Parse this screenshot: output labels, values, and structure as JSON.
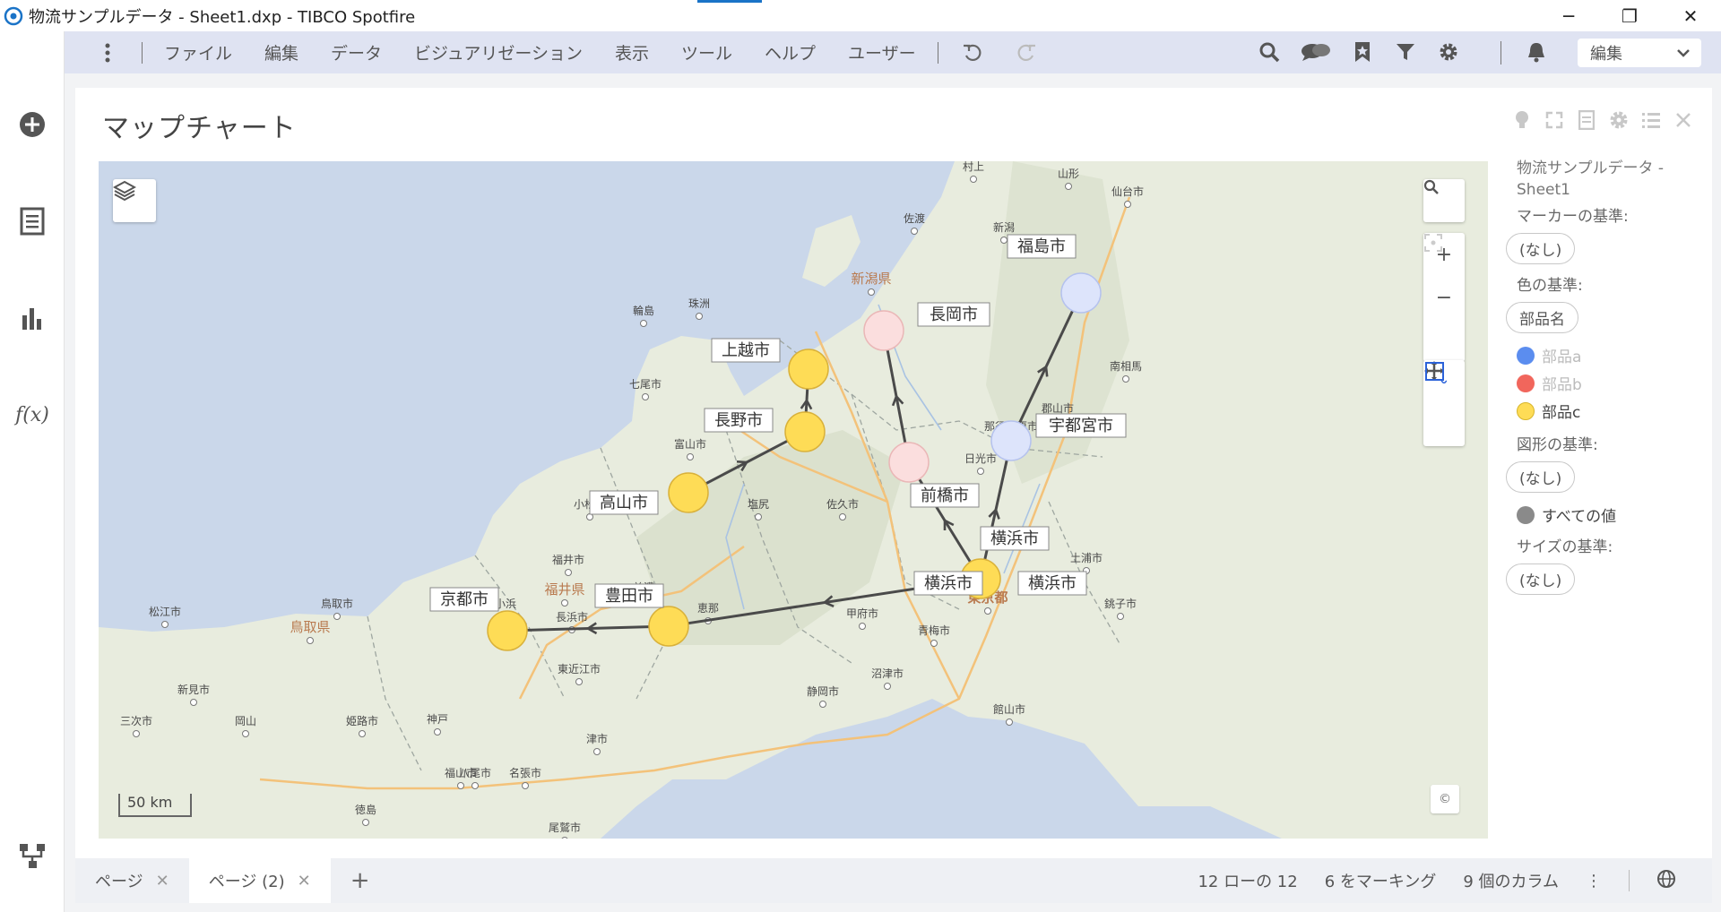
{
  "window": {
    "title": "物流サンプルデータ - Sheet1.dxp - TIBCO Spotfire",
    "min": "─",
    "max": "❐",
    "close": "✕"
  },
  "menu": {
    "items": [
      "ファイル",
      "編集",
      "データ",
      "ビジュアリゼーション",
      "表示",
      "ツール",
      "ヘルプ",
      "ユーザー"
    ],
    "mode": "編集"
  },
  "panel": {
    "title": "マップチャート"
  },
  "map": {
    "scale_label": "50 km",
    "copyright": "©",
    "zoom_in": "+",
    "zoom_out": "−",
    "base_labels": [
      {
        "t": "仙台市"
      },
      {
        "t": "山形"
      },
      {
        "t": "村上"
      },
      {
        "t": "新潟"
      },
      {
        "t": "新潟県"
      },
      {
        "t": "佐渡"
      },
      {
        "t": "輪島"
      },
      {
        "t": "珠洲"
      },
      {
        "t": "七尾市"
      },
      {
        "t": "富山市"
      },
      {
        "t": "小松市"
      },
      {
        "t": "福井市"
      },
      {
        "t": "福井県"
      },
      {
        "t": "鳥取県"
      },
      {
        "t": "鳥取市"
      },
      {
        "t": "松江市"
      },
      {
        "t": "新見市"
      },
      {
        "t": "三次市"
      },
      {
        "t": "岡山"
      },
      {
        "t": "姫路市"
      },
      {
        "t": "神戸"
      },
      {
        "t": "八尾市"
      },
      {
        "t": "名張市"
      },
      {
        "t": "津市"
      },
      {
        "t": "静岡市"
      },
      {
        "t": "沼津市"
      },
      {
        "t": "甲府市"
      },
      {
        "t": "東京都"
      },
      {
        "t": "土浦市"
      },
      {
        "t": "銚子市"
      },
      {
        "t": "日光市"
      },
      {
        "t": "郡山市"
      },
      {
        "t": "南相馬"
      },
      {
        "t": "佐久市"
      },
      {
        "t": "塩尻"
      },
      {
        "t": "美濃"
      },
      {
        "t": "恵那"
      },
      {
        "t": "長浜市"
      },
      {
        "t": "東近江市"
      },
      {
        "t": "小浜"
      },
      {
        "t": "福山市"
      },
      {
        "t": "徳島"
      },
      {
        "t": "尾鷲市"
      },
      {
        "t": "館山市"
      },
      {
        "t": "青梅市"
      },
      {
        "t": "那須塩原市"
      }
    ],
    "city_labels": [
      "福島市",
      "長岡市",
      "上越市",
      "長野市",
      "宇都宮市",
      "前橋市",
      "高山市",
      "横浜市",
      "横浜市",
      "横浜市",
      "豊田市",
      "京都市"
    ],
    "markers": [
      {
        "city": "福島市",
        "part": "部品a"
      },
      {
        "city": "宇都宮市",
        "part": "部品a"
      },
      {
        "city": "長岡市",
        "part": "部品b"
      },
      {
        "city": "前橋市",
        "part": "部品b"
      },
      {
        "city": "上越市",
        "part": "部品c"
      },
      {
        "city": "長野市",
        "part": "部品c"
      },
      {
        "city": "高山市",
        "part": "部品c"
      },
      {
        "city": "横浜市",
        "part": "部品c"
      },
      {
        "city": "豊田市",
        "part": "部品c"
      },
      {
        "city": "京都市",
        "part": "部品c"
      }
    ],
    "routes": [
      [
        "宇都宮市",
        "福島市"
      ],
      [
        "横浜市",
        "宇都宮市"
      ],
      [
        "前橋市",
        "長岡市"
      ],
      [
        "横浜市",
        "前橋市"
      ],
      [
        "長野市",
        "上越市"
      ],
      [
        "高山市",
        "長野市"
      ],
      [
        "横浜市",
        "豊田市"
      ],
      [
        "豊田市",
        "京都市"
      ]
    ]
  },
  "legend": {
    "dataset": "物流サンプルデータ - Sheet1",
    "marker_by_label": "マーカーの基準:",
    "marker_by_value": "(なし)",
    "color_by_label": "色の基準:",
    "color_by_value": "部品名",
    "color_items": [
      {
        "label": "部品a",
        "color": "#5b8def",
        "active": false
      },
      {
        "label": "部品b",
        "color": "#f1665c",
        "active": false
      },
      {
        "label": "部品c",
        "color": "#fedc56",
        "active": true
      }
    ],
    "shape_by_label": "図形の基準:",
    "shape_by_value": "(なし)",
    "shape_all_label": "すべての値",
    "size_by_label": "サイズの基準:",
    "size_by_value": "(なし)"
  },
  "bottom": {
    "tabs": [
      "ページ",
      "ページ (2)"
    ],
    "add": "+",
    "rows": "12 ローの 12",
    "marked": "6 をマーキング",
    "columns": "9 個のカラム",
    "more": "⋮"
  },
  "colors": {
    "accent": "#1a73c7",
    "part_a_faded": "#dde4fb",
    "part_b_faded": "#fbdede",
    "part_c": "#fedc56",
    "menubar": "#dfe3f2"
  }
}
